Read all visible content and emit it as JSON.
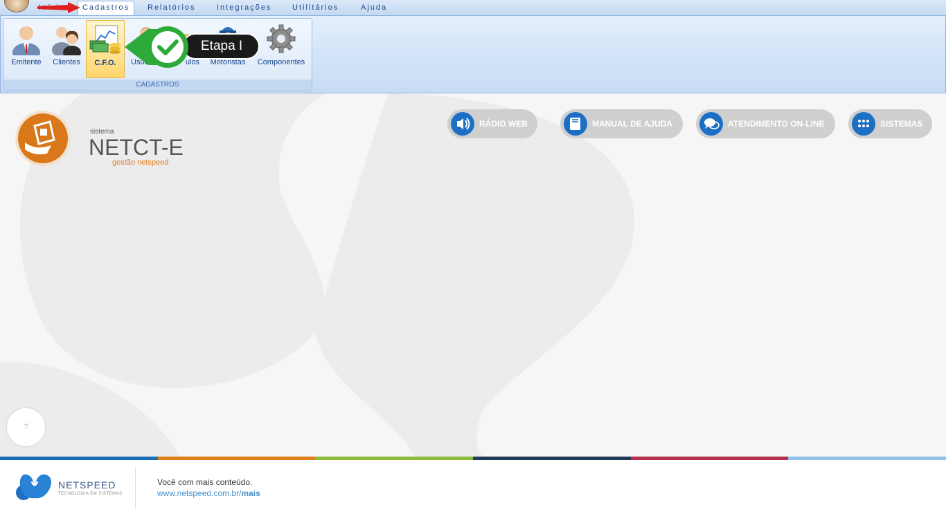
{
  "ribbon": {
    "tabs": [
      "Início",
      "Cadastros",
      "Relatórios",
      "Integrações",
      "Utilitários",
      "Ajuda"
    ],
    "active_tab": "Cadastros",
    "group_title": "CADASTROS",
    "buttons": [
      {
        "label": "Emitente",
        "icon": "user-icon"
      },
      {
        "label": "Clientes",
        "icon": "users-icon"
      },
      {
        "label": "C.F.O.",
        "icon": "money-chart-icon"
      },
      {
        "label": "Usuá",
        "icon": "user-icon"
      },
      {
        "label": "ulos",
        "icon": "folder-icon"
      },
      {
        "label": "Motoristas",
        "icon": "driver-icon"
      },
      {
        "label": "Componentes",
        "icon": "gear-icon"
      }
    ]
  },
  "callout": {
    "label": "Etapa I",
    "color": "#2eaa3a"
  },
  "brand": {
    "small": "sistema",
    "name": "NETCT-E",
    "sub": "gestão netspeed",
    "accent": "#e07e1a"
  },
  "actions": [
    {
      "label": "RÁDIO WEB",
      "icon": "speaker-icon"
    },
    {
      "label": "MANUAL DE AJUDA",
      "icon": "book-icon"
    },
    {
      "label": "ATENDIMENTO ON-LINE",
      "icon": "chat-icon"
    },
    {
      "label": "SISTEMAS",
      "icon": "grid-icon"
    }
  ],
  "help": {
    "label": "?"
  },
  "footer": {
    "brand": "NETSPEED",
    "tagline": "TECNOLOGIA EM SISTEMAS",
    "line1": "Você com mais conteúdo.",
    "link_prefix": "www.netspeed.com.br/",
    "link_suffix": "mais",
    "colors": [
      "#1b6fb8",
      "#e07e1a",
      "#8dbb3b",
      "#1f3b55",
      "#b5304a",
      "#8fc3ec"
    ]
  }
}
